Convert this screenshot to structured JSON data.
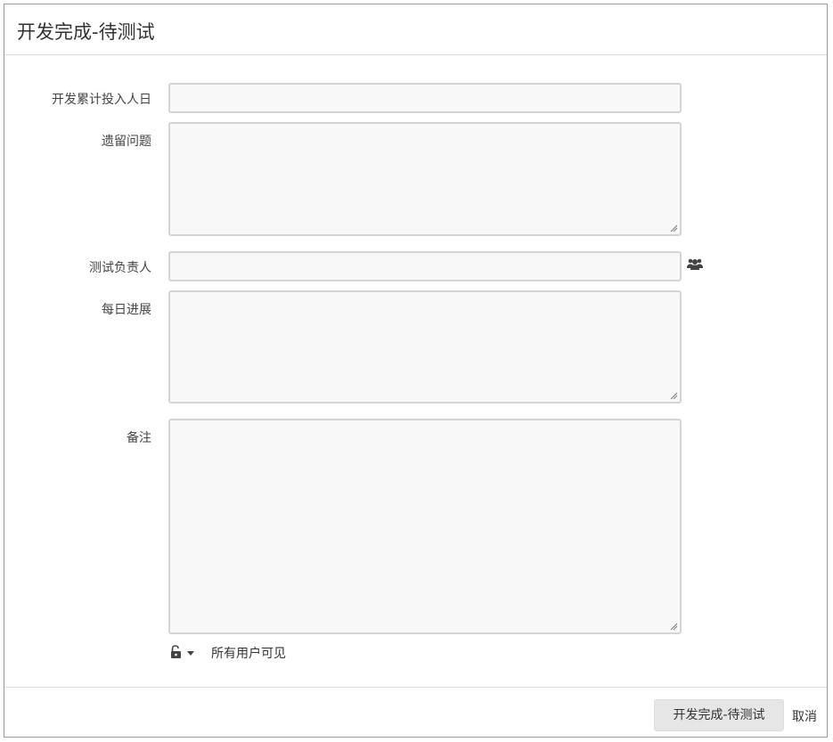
{
  "dialog": {
    "title": "开发完成-待测试"
  },
  "form": {
    "fields": [
      {
        "label": "开发累计投入人日",
        "value": ""
      },
      {
        "label": "遗留问题",
        "value": ""
      },
      {
        "label": "测试负责人",
        "value": ""
      },
      {
        "label": "每日进展",
        "value": ""
      },
      {
        "label": "备注",
        "value": ""
      }
    ],
    "visibility": {
      "label": "所有用户可见",
      "icon": "unlock-icon"
    },
    "assignee_picker_icon": "users-icon"
  },
  "footer": {
    "submit_label": "开发完成-待测试",
    "cancel_label": "取消"
  }
}
